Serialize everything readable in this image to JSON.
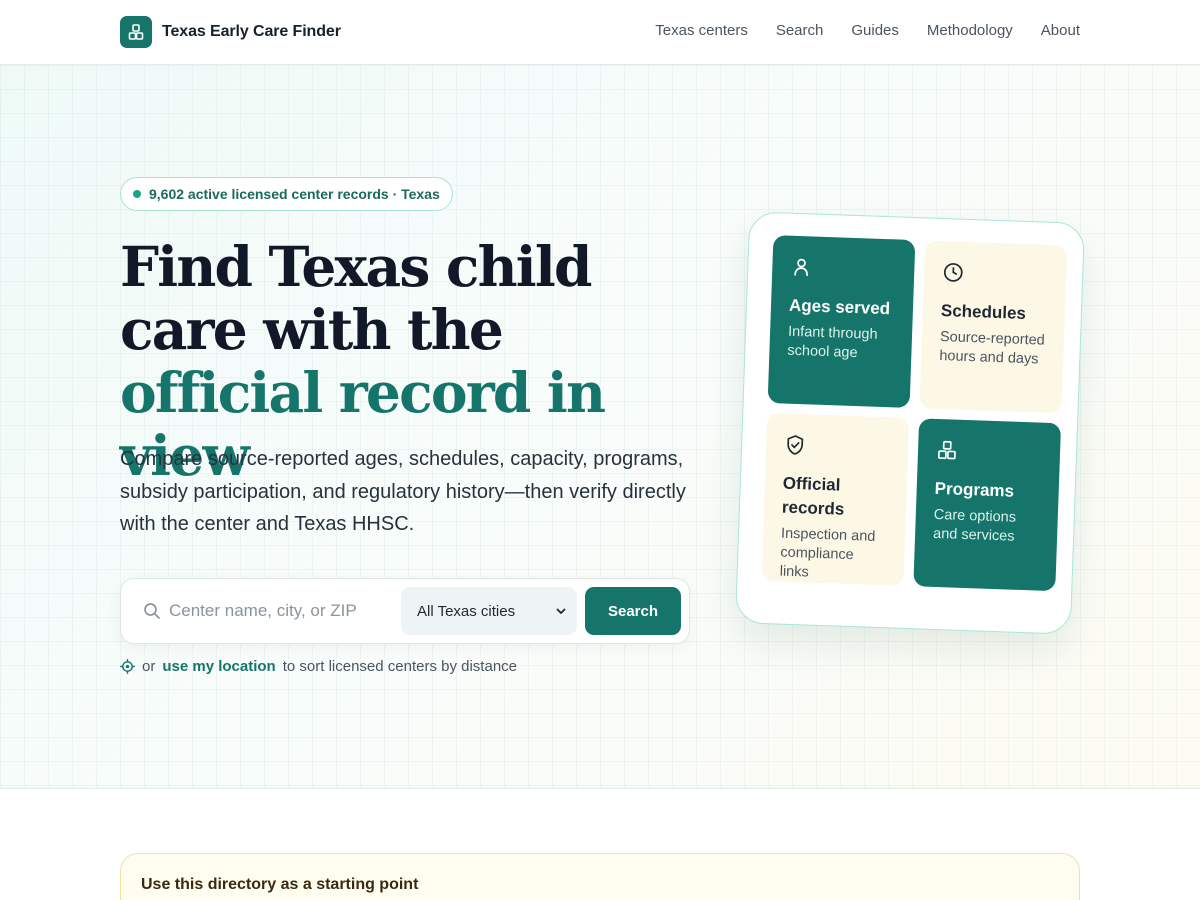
{
  "header": {
    "brand": "Texas Early Care Finder",
    "nav": [
      {
        "label": "Texas centers"
      },
      {
        "label": "Search"
      },
      {
        "label": "Guides"
      },
      {
        "label": "Methodology"
      },
      {
        "label": "About"
      }
    ]
  },
  "hero": {
    "badge": "9,602 active licensed center records · Texas",
    "headline_part1": "Find Texas child care with the ",
    "headline_accent": "official record in view",
    "lede": "Compare source-reported ages, schedules, capacity, programs, subsidy participation, and regulatory history—then verify directly with the center and Texas HHSC.",
    "search": {
      "placeholder": "Center name, city, or ZIP",
      "value": "",
      "city_selected": "All Texas cities",
      "button_label": "Search"
    },
    "location": {
      "prefix": "or",
      "link": "use my location",
      "suffix": "to sort licensed centers by distance"
    }
  },
  "features": [
    {
      "icon": "person-icon",
      "title": "Ages served",
      "desc": "Infant through school age"
    },
    {
      "icon": "clock-icon",
      "title": "Schedules",
      "desc": "Source-reported hours and days"
    },
    {
      "icon": "shield-check-icon",
      "title": "Official records",
      "desc": "Inspection and compliance links"
    },
    {
      "icon": "blocks-icon",
      "title": "Programs",
      "desc": "Care options and services"
    }
  ],
  "notice": {
    "title": "Use this directory as a starting point"
  },
  "colors": {
    "brand": "#16756b",
    "badge_dot": "#19a58c",
    "tile_light": "#fdf8e5",
    "notice_bg": "#fffdf0"
  }
}
